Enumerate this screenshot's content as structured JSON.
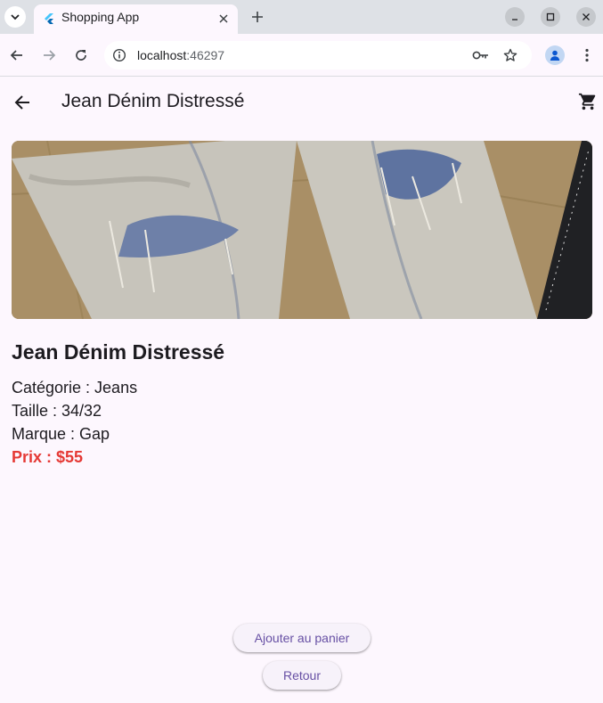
{
  "browser": {
    "tab_title": "Shopping App",
    "url_host": "localhost",
    "url_port": ":46297"
  },
  "appbar": {
    "title": "Jean Dénim Distressé"
  },
  "product": {
    "name": "Jean Dénim Distressé",
    "category": "Catégorie : Jeans",
    "size": "Taille : 34/32",
    "brand": "Marque : Gap",
    "price": "Prix : $55"
  },
  "actions": {
    "add_to_cart": "Ajouter au panier",
    "back": "Retour"
  },
  "colors": {
    "background": "#fdf7fe",
    "price": "#e53935",
    "button_text": "#6750a4"
  },
  "icons": [
    "tab-menu-icon",
    "flutter-icon",
    "close-icon",
    "plus-icon",
    "minimize-icon",
    "maximize-icon",
    "back-icon",
    "forward-icon",
    "reload-icon",
    "info-icon",
    "key-icon",
    "star-icon",
    "profile-icon",
    "more-vert-icon",
    "arrow-back-icon",
    "shopping-cart-icon"
  ]
}
